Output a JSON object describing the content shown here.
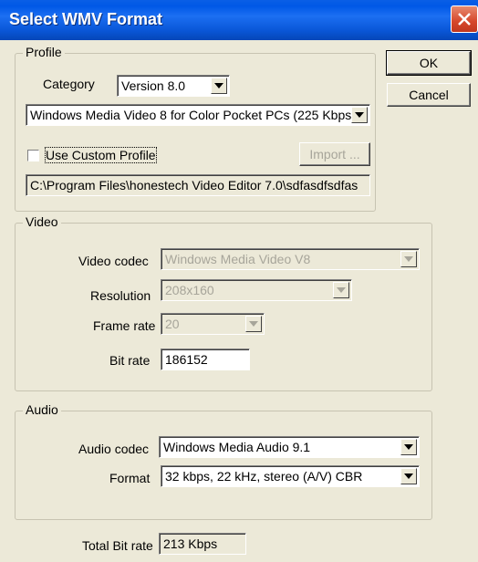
{
  "window": {
    "title": "Select WMV Format"
  },
  "buttons": {
    "ok": "OK",
    "cancel": "Cancel",
    "import": "Import ..."
  },
  "profile": {
    "group_label": "Profile",
    "category_label": "Category",
    "category_value": "Version 8.0",
    "profile_value": "Windows Media Video 8 for Color Pocket PCs (225 Kbps)",
    "custom_profile_label": "Use Custom Profile",
    "custom_profile_checked": false,
    "path_value": "C:\\Program Files\\honestech Video Editor 7.0\\sdfasdfsdfas"
  },
  "video": {
    "group_label": "Video",
    "codec_label": "Video codec",
    "codec_value": "Windows Media Video V8",
    "resolution_label": "Resolution",
    "resolution_value": "208x160",
    "framerate_label": "Frame rate",
    "framerate_value": "20",
    "bitrate_label": "Bit rate",
    "bitrate_value": "186152"
  },
  "audio": {
    "group_label": "Audio",
    "codec_label": "Audio codec",
    "codec_value": "Windows Media Audio 9.1",
    "format_label": "Format",
    "format_value": "32 kbps, 22 kHz, stereo (A/V) CBR"
  },
  "total": {
    "label": "Total Bit rate",
    "value": "213 Kbps"
  }
}
